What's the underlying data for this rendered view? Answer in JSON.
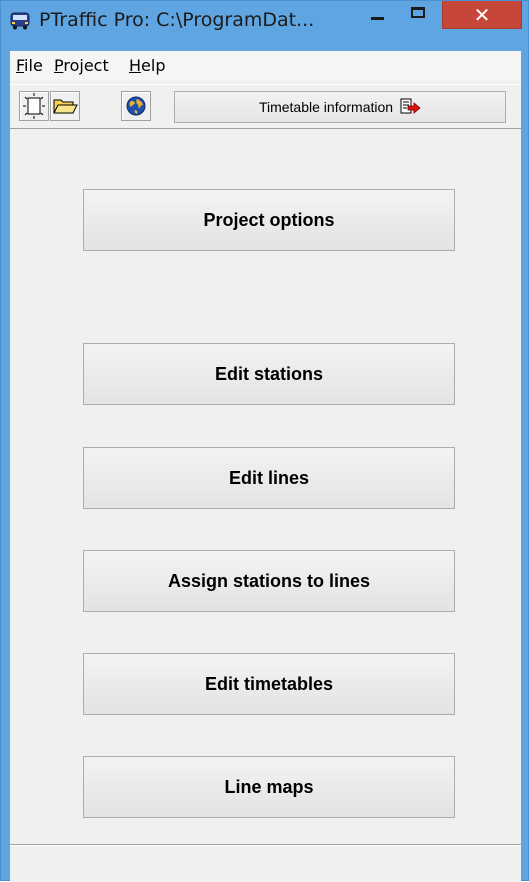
{
  "window": {
    "title": "PTraffic Pro:  C:\\ProgramDat...",
    "minimize_symbol": "—",
    "close_symbol": "✕"
  },
  "menu": {
    "items": [
      {
        "accel": "F",
        "rest": "ile"
      },
      {
        "accel": "P",
        "rest": "roject"
      },
      {
        "accel": "H",
        "rest": "elp"
      }
    ]
  },
  "toolbar": {
    "icons": [
      "new-project-icon",
      "open-folder-icon",
      "globe-icon"
    ],
    "timetable_label": "Timetable information"
  },
  "buttons": {
    "project_options": "Project options",
    "edit_stations": "Edit stations",
    "edit_lines": "Edit lines",
    "assign_stations": "Assign stations to lines",
    "edit_timetables": "Edit timetables",
    "line_maps": "Line maps"
  },
  "colors": {
    "titlebar": "#5ea5e2",
    "close_button": "#c7463a",
    "client_bg": "#f0f0f0"
  }
}
